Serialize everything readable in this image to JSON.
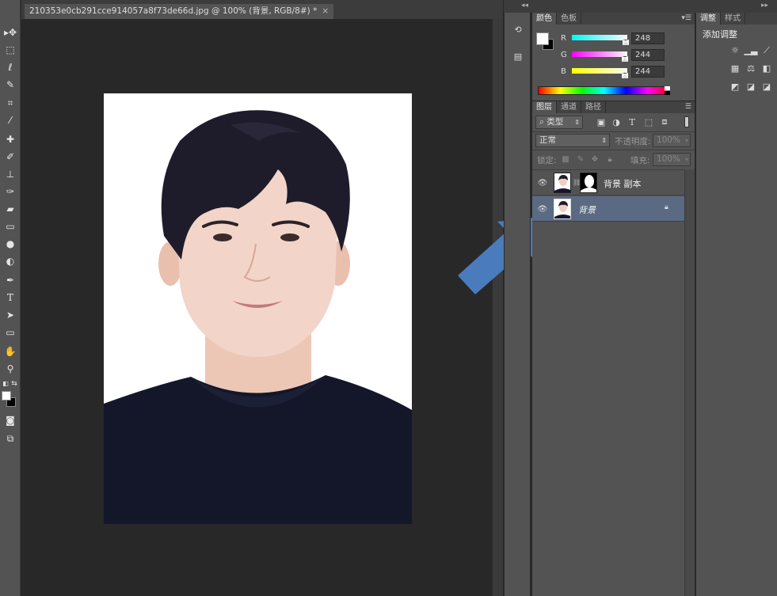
{
  "document": {
    "tab_title": "210353e0cb291cce914057a8f73de66d.jpg @ 100% (背景, RGB/8#) *",
    "close_glyph": "×"
  },
  "toolbar": {
    "tools": [
      {
        "name": "move-tool",
        "glyph": "▸✥"
      },
      {
        "name": "marquee-tool",
        "glyph": "⬚"
      },
      {
        "name": "lasso-tool",
        "glyph": "ℓ"
      },
      {
        "name": "quick-select-tool",
        "glyph": "✎"
      },
      {
        "name": "crop-tool",
        "glyph": "⌗"
      },
      {
        "name": "eyedropper-tool",
        "glyph": "⁄"
      },
      {
        "name": "healing-brush-tool",
        "glyph": "✚"
      },
      {
        "name": "brush-tool",
        "glyph": "✐"
      },
      {
        "name": "clone-stamp-tool",
        "glyph": "⊥"
      },
      {
        "name": "history-brush-tool",
        "glyph": "✑"
      },
      {
        "name": "eraser-tool",
        "glyph": "▰"
      },
      {
        "name": "gradient-tool",
        "glyph": "▭"
      },
      {
        "name": "blur-tool",
        "glyph": "●"
      },
      {
        "name": "dodge-tool",
        "glyph": "◐"
      },
      {
        "name": "pen-tool",
        "glyph": "✒"
      },
      {
        "name": "type-tool",
        "glyph": "T"
      },
      {
        "name": "path-select-tool",
        "glyph": "➤"
      },
      {
        "name": "shape-tool",
        "glyph": "▭"
      },
      {
        "name": "hand-tool",
        "glyph": "✋"
      },
      {
        "name": "zoom-tool",
        "glyph": "⚲"
      }
    ],
    "foreground_color": "#ffffff",
    "background_color": "#000000"
  },
  "color_panel": {
    "tabs": [
      "颜色",
      "色板"
    ],
    "menu_glyph": "▾☰",
    "channels": [
      {
        "label": "R",
        "value": "248",
        "gradient_from": "#00f8f8",
        "gradient_to": "#f8f8f8",
        "level": 0.97
      },
      {
        "label": "G",
        "value": "244",
        "gradient_from": "#ff00ff",
        "gradient_to": "#f8f8f8",
        "level": 0.96
      },
      {
        "label": "B",
        "value": "244",
        "gradient_from": "#ffff00",
        "gradient_to": "#f8f8f8",
        "level": 0.96
      }
    ]
  },
  "layers_panel": {
    "tabs": [
      "图层",
      "通道",
      "路径"
    ],
    "menu_glyph": "☰",
    "filter_label": "类型",
    "filter_icon": "⌕",
    "filter_icons": [
      "image-filter-icon",
      "adjustment-filter-icon",
      "type-filter-icon",
      "shape-filter-icon",
      "smart-object-filter-icon"
    ],
    "blend_mode": "正常",
    "opacity_label": "不透明度:",
    "opacity_value": "100%",
    "lock_label": "锁定:",
    "fill_label": "填充:",
    "fill_value": "100%",
    "layers": [
      {
        "name": "背景 副本",
        "selected": false,
        "has_mask": true,
        "locked": false
      },
      {
        "name": "背景",
        "selected": true,
        "has_mask": false,
        "locked": true
      }
    ]
  },
  "adjust_panel": {
    "tabs": [
      "调整",
      "样式"
    ],
    "title": "添加调整"
  },
  "annotation": {
    "arrow_color": "#4a7bbd"
  }
}
